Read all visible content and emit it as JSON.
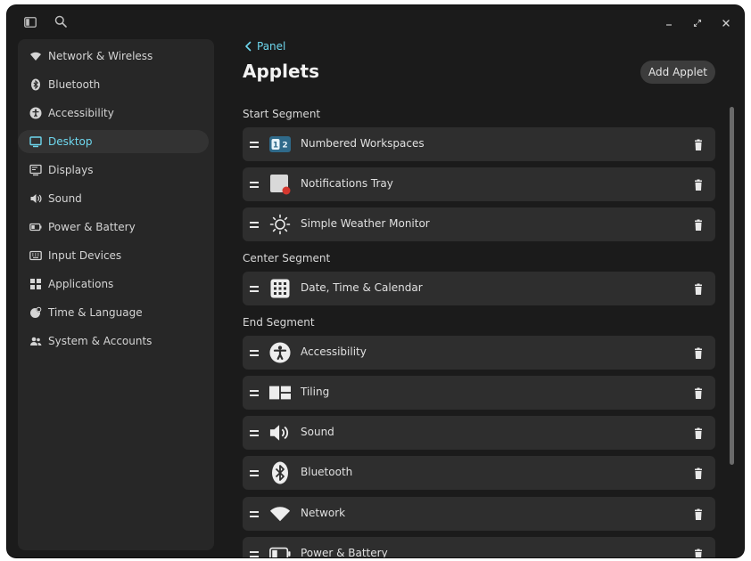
{
  "sidebar": {
    "items": [
      {
        "label": "Network & Wireless",
        "icon": "wifi-icon",
        "active": false
      },
      {
        "label": "Bluetooth",
        "icon": "bluetooth-icon",
        "active": false
      },
      {
        "label": "Accessibility",
        "icon": "accessibility-icon",
        "active": false
      },
      {
        "label": "Desktop",
        "icon": "desktop-icon",
        "active": true
      },
      {
        "label": "Displays",
        "icon": "displays-icon",
        "active": false
      },
      {
        "label": "Sound",
        "icon": "sound-icon",
        "active": false
      },
      {
        "label": "Power & Battery",
        "icon": "battery-icon",
        "active": false
      },
      {
        "label": "Input Devices",
        "icon": "keyboard-icon",
        "active": false
      },
      {
        "label": "Applications",
        "icon": "apps-grid-icon",
        "active": false
      },
      {
        "label": "Time & Language",
        "icon": "globe-clock-icon",
        "active": false
      },
      {
        "label": "System & Accounts",
        "icon": "users-icon",
        "active": false
      }
    ]
  },
  "header": {
    "back_label": "Panel",
    "title": "Applets",
    "add_label": "Add Applet"
  },
  "segments": {
    "start": {
      "label": "Start Segment",
      "applets": [
        {
          "name": "Numbered Workspaces",
          "icon": "workspaces-icon"
        },
        {
          "name": "Notifications Tray",
          "icon": "notifications-icon"
        },
        {
          "name": "Simple Weather Monitor",
          "icon": "sun-icon"
        }
      ]
    },
    "center": {
      "label": "Center Segment",
      "applets": [
        {
          "name": "Date, Time & Calendar",
          "icon": "calendar-icon"
        }
      ]
    },
    "end": {
      "label": "End Segment",
      "applets": [
        {
          "name": "Accessibility",
          "icon": "accessibility-icon"
        },
        {
          "name": "Tiling",
          "icon": "tiling-icon"
        },
        {
          "name": "Sound",
          "icon": "speaker-icon"
        },
        {
          "name": "Bluetooth",
          "icon": "bluetooth-icon"
        },
        {
          "name": "Network",
          "icon": "wifi-icon"
        },
        {
          "name": "Power & Battery",
          "icon": "battery-icon"
        }
      ]
    }
  },
  "colors": {
    "accent": "#6ed7ee",
    "window": "#1b1b1b",
    "row": "#2e2e2e"
  }
}
